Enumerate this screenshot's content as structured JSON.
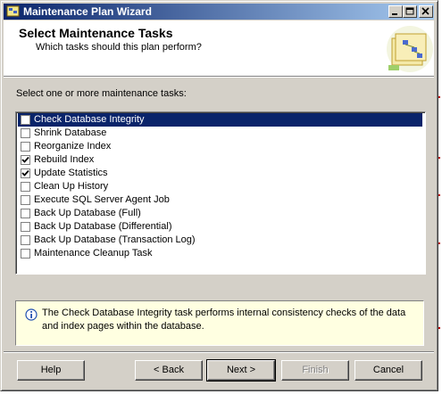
{
  "window": {
    "title": "Maintenance Plan Wizard"
  },
  "header": {
    "title": "Select Maintenance Tasks",
    "subtitle": "Which tasks should this plan perform?"
  },
  "task_list": {
    "label": "Select one or more maintenance tasks:",
    "items": [
      {
        "label": "Check Database Integrity",
        "checked": false,
        "selected": true
      },
      {
        "label": "Shrink Database",
        "checked": false,
        "selected": false
      },
      {
        "label": "Reorganize Index",
        "checked": false,
        "selected": false
      },
      {
        "label": "Rebuild Index",
        "checked": true,
        "selected": false
      },
      {
        "label": "Update Statistics",
        "checked": true,
        "selected": false
      },
      {
        "label": "Clean Up History",
        "checked": false,
        "selected": false
      },
      {
        "label": "Execute SQL Server Agent Job",
        "checked": false,
        "selected": false
      },
      {
        "label": "Back Up Database (Full)",
        "checked": false,
        "selected": false
      },
      {
        "label": "Back Up Database (Differential)",
        "checked": false,
        "selected": false
      },
      {
        "label": "Back Up Database (Transaction Log)",
        "checked": false,
        "selected": false
      },
      {
        "label": "Maintenance Cleanup Task",
        "checked": false,
        "selected": false
      }
    ]
  },
  "description": {
    "text": "The Check Database Integrity task performs internal consistency checks of the data and index pages within the database."
  },
  "buttons": {
    "help": "Help",
    "back": "< Back",
    "next": "Next >",
    "finish": "Finish",
    "cancel": "Cancel"
  },
  "colors": {
    "titlebar_start": "#0a246a",
    "titlebar_end": "#a6caf0",
    "selection": "#0a246a",
    "dialog_face": "#d4d0c8",
    "info_background": "#ffffe1"
  },
  "icons": {
    "app": "wizard-app-icon",
    "header_art": "maintenance-plan-wizard-graphic",
    "info": "info-icon",
    "check": "checkmark-icon"
  }
}
